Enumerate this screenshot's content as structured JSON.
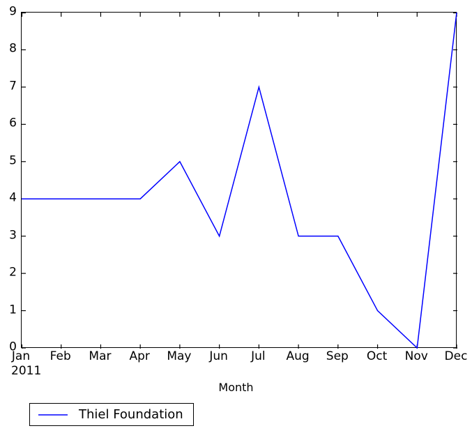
{
  "chart_data": {
    "type": "line",
    "title": "",
    "xlabel": "Month",
    "ylabel": "",
    "categories": [
      "Jan",
      "Feb",
      "Mar",
      "Apr",
      "May",
      "Jun",
      "Jul",
      "Aug",
      "Sep",
      "Oct",
      "Nov",
      "Dec"
    ],
    "year_label": "2011",
    "series": [
      {
        "name": "Thiel Foundation",
        "color": "#0000ff",
        "values": [
          4,
          4,
          4,
          4,
          5,
          3,
          7,
          3,
          3,
          1,
          0,
          9
        ]
      }
    ],
    "ylim": [
      0,
      9
    ],
    "yticks": [
      0,
      1,
      2,
      3,
      4,
      5,
      6,
      7,
      8,
      9
    ],
    "ytick_labels": [
      "0",
      "1",
      "2",
      "3",
      "4",
      "5",
      "6",
      "7",
      "8",
      "9"
    ],
    "grid": false,
    "legend_position": "below-left"
  },
  "legend": {
    "entries": [
      {
        "label": "Thiel Foundation",
        "color": "#0000ff"
      }
    ]
  },
  "axis": {
    "x_title": "Month",
    "year": "2011"
  }
}
